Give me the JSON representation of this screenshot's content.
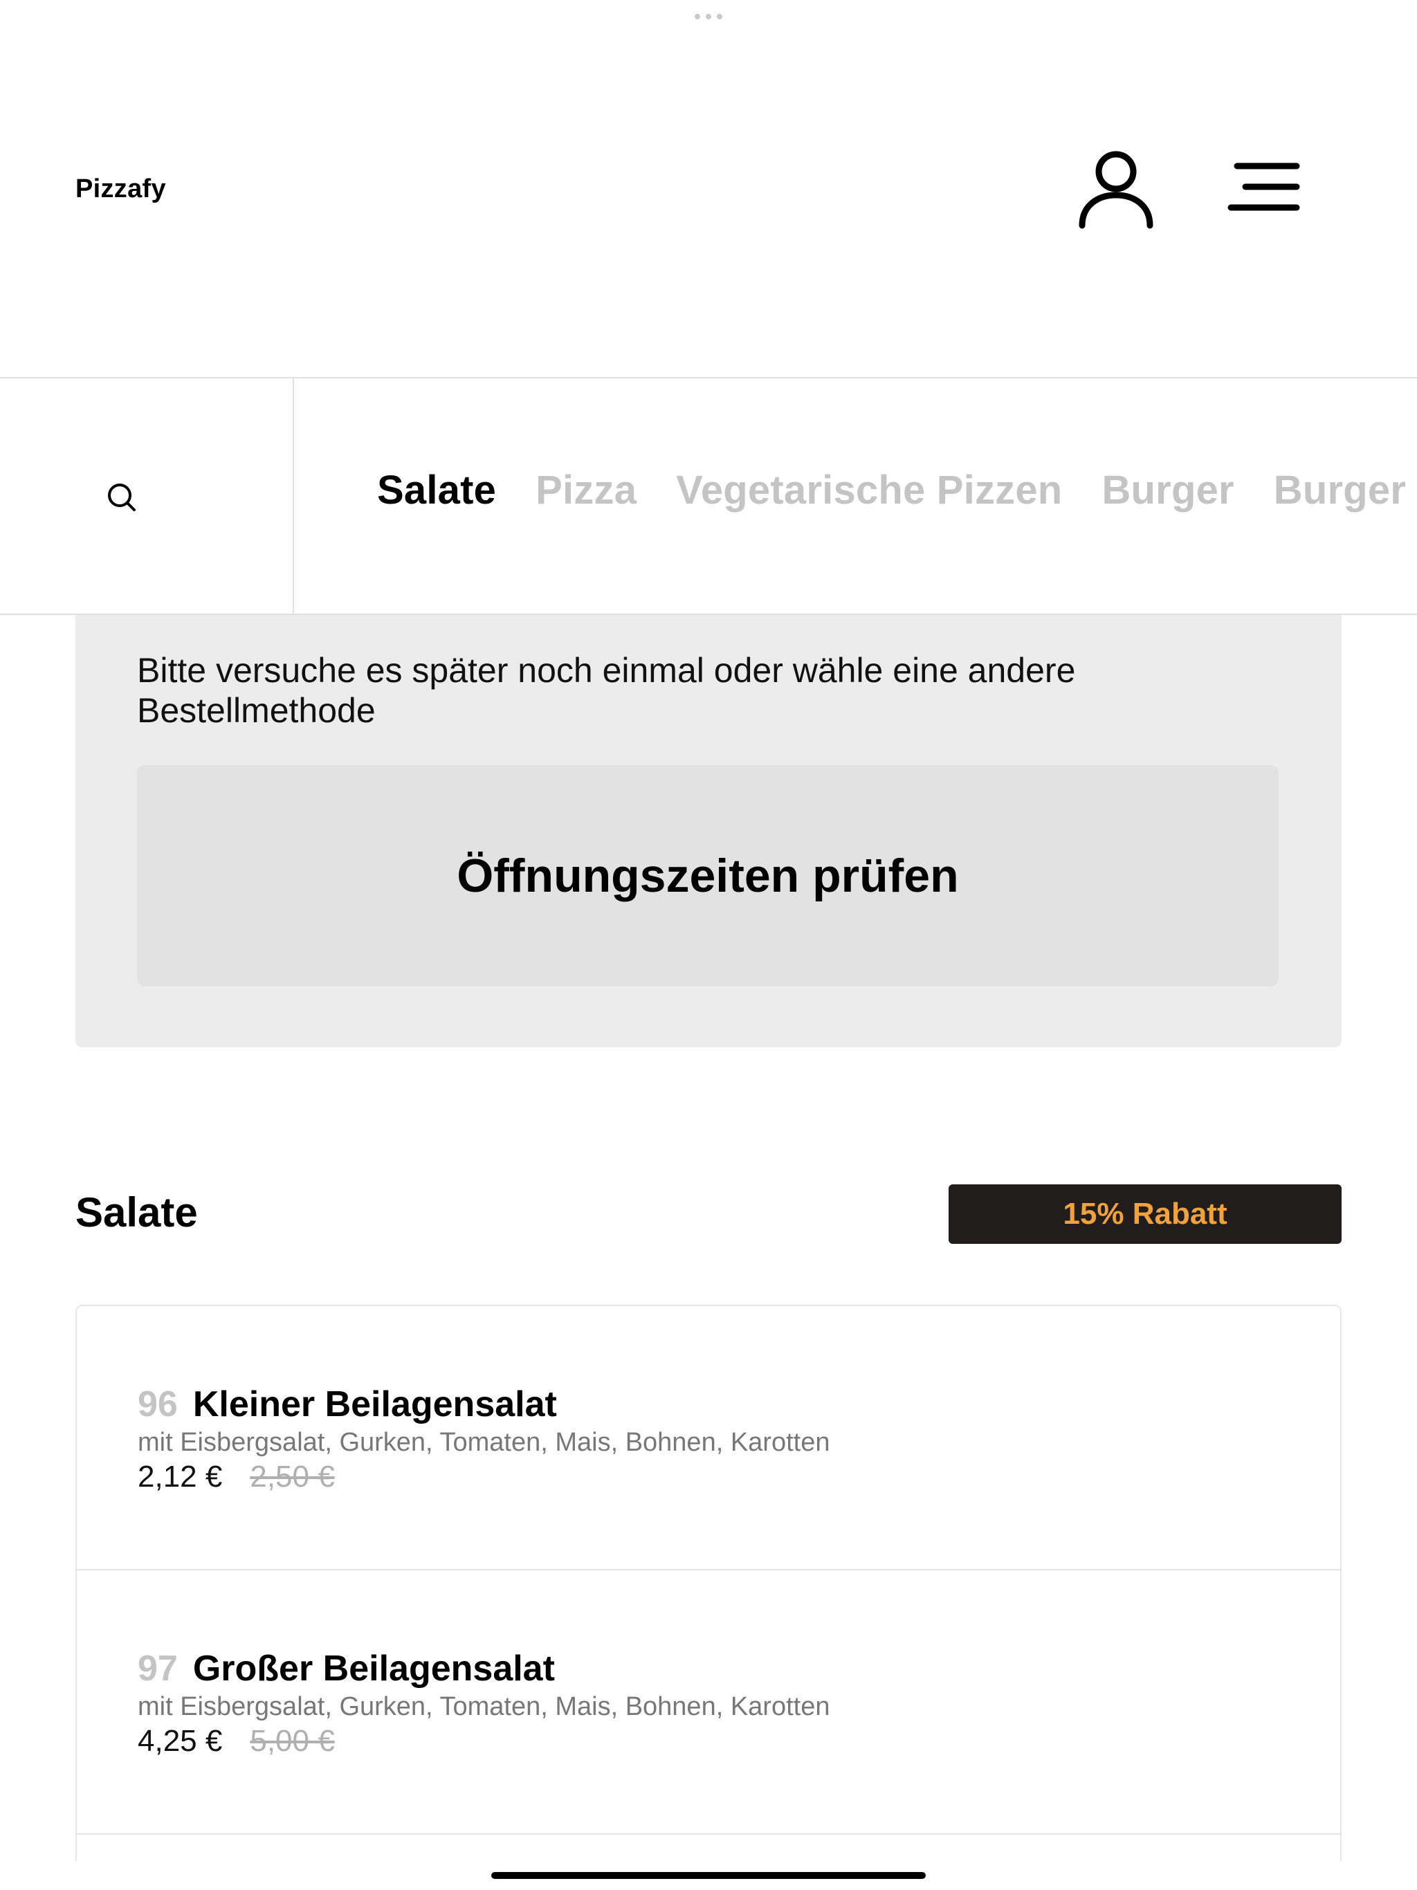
{
  "header": {
    "brand": "Pizzafy",
    "user_icon": "user-icon",
    "menu_icon": "menu-icon"
  },
  "nav": {
    "search_icon": "search-icon",
    "categories": [
      {
        "label": "Salate",
        "active": true
      },
      {
        "label": "Pizza",
        "active": false
      },
      {
        "label": "Vegetarische Pizzen",
        "active": false
      },
      {
        "label": "Burger",
        "active": false
      },
      {
        "label": "Burger Menü",
        "active": false
      }
    ]
  },
  "notice": {
    "message": "Bitte versuche es später noch einmal oder wähle eine andere Bestellmethode",
    "button_label": "Öffnungszeiten prüfen"
  },
  "section": {
    "title": "Salate",
    "discount_label": "15% Rabatt"
  },
  "products": [
    {
      "number": "96",
      "name": "Kleiner Beilagensalat",
      "description": "mit Eisbergsalat, Gurken, Tomaten, Mais, Bohnen, Karotten",
      "price": "2,12 €",
      "old_price": "2,50 €"
    },
    {
      "number": "97",
      "name": "Großer Beilagensalat",
      "description": "mit Eisbergsalat, Gurken, Tomaten, Mais, Bohnen, Karotten",
      "price": "4,25 €",
      "old_price": "5,00 €"
    }
  ],
  "colors": {
    "accent": "#f2a23a",
    "badge_bg": "#211d1c",
    "muted": "#c4c4c4",
    "card_bg": "#ececec"
  }
}
